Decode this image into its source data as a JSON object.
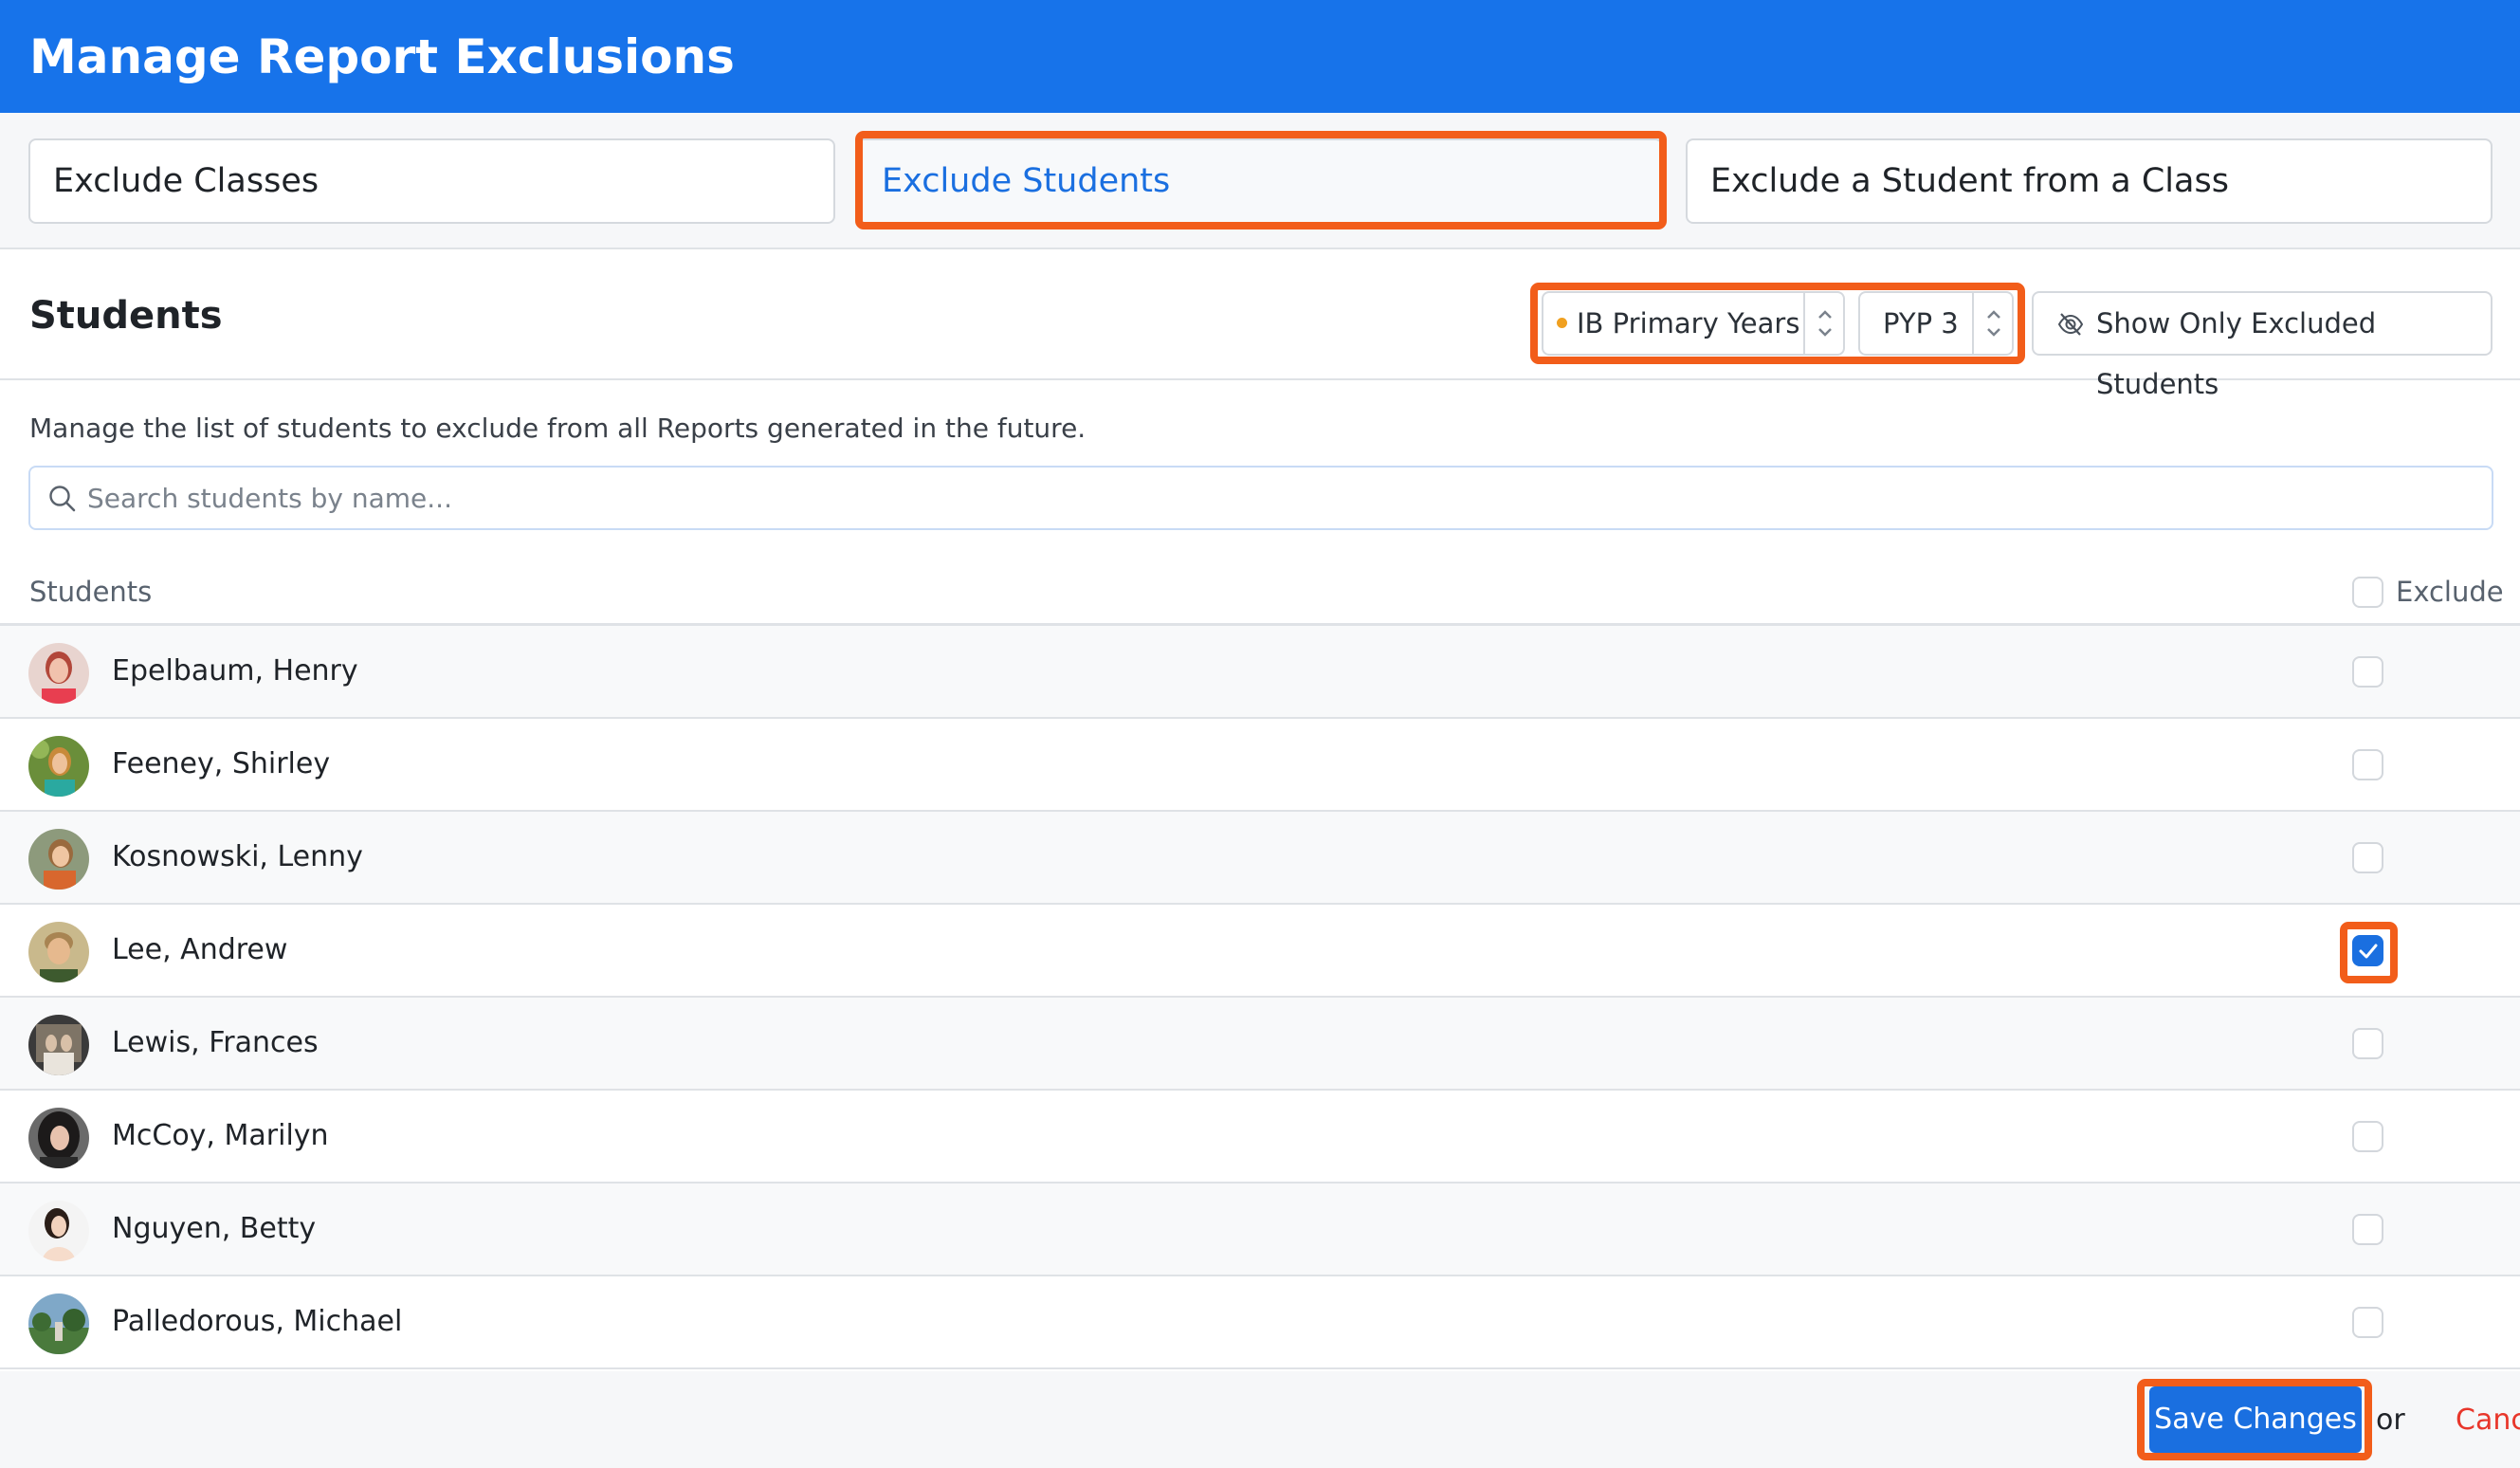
{
  "header": {
    "title": "Manage Report Exclusions"
  },
  "tabs": [
    {
      "label": "Exclude Classes",
      "active": false
    },
    {
      "label": "Exclude Students",
      "active": true
    },
    {
      "label": "Exclude a Student from a Class",
      "active": false
    }
  ],
  "section": {
    "title": "Students",
    "program_select": {
      "value": "IB Primary Years"
    },
    "grade_select": {
      "value": "PYP 3"
    },
    "filter_button": {
      "label": "Show Only Excluded Students",
      "icon": "eye-slash-icon"
    },
    "description": "Manage the list of students to exclude from all Reports generated in the future.",
    "search": {
      "placeholder": "Search students by name...",
      "value": ""
    }
  },
  "table": {
    "col_students": "Students",
    "col_exclude": "Exclude",
    "select_all_checked": false,
    "rows": [
      {
        "name": "Epelbaum, Henry",
        "excluded": false
      },
      {
        "name": "Feeney, Shirley",
        "excluded": false
      },
      {
        "name": "Kosnowski, Lenny",
        "excluded": false
      },
      {
        "name": "Lee, Andrew",
        "excluded": true
      },
      {
        "name": "Lewis, Frances",
        "excluded": false
      },
      {
        "name": "McCoy, Marilyn",
        "excluded": false
      },
      {
        "name": "Nguyen, Betty",
        "excluded": false
      },
      {
        "name": "Palledorous, Michael",
        "excluded": false
      }
    ]
  },
  "footer": {
    "save_label": "Save Changes",
    "or_label": "or",
    "cancel_label": "Cancel"
  },
  "colors": {
    "header_bg": "#1773ea",
    "accent": "#1a6fe0",
    "highlight": "#f25d1a",
    "cancel": "#e8362b",
    "program_dot": "#f0a020"
  }
}
